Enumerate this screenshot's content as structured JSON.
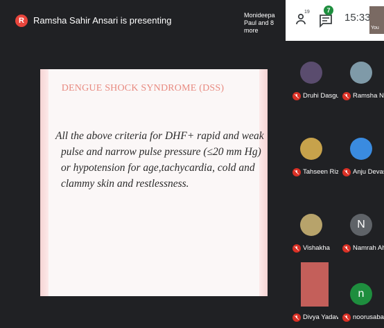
{
  "presenter": {
    "initial": "R",
    "status": "Ramsha Sahir Ansari is presenting"
  },
  "also_present": "Monideepa Paul and 8 more",
  "top_right": {
    "people_count": "19",
    "chat_badge": "7",
    "time": "15:33",
    "you_label": "You"
  },
  "slide": {
    "title": "DENGUE SHOCK SYNDROME (DSS)",
    "lines": [
      "All the above criteria for DHF+ rapid and weak",
      "pulse and narrow pulse pressure (≤20 mm Hg)",
      "or hypotension for age,tachycardia, cold and",
      "clammy skin and restlessness."
    ]
  },
  "participants": [
    {
      "name": "Druhi Dasgupta",
      "avatar": "photo",
      "color": "#5a4c6e"
    },
    {
      "name": "Ramsha Neyaz",
      "avatar": "photo",
      "color": "#7f9aa8"
    },
    {
      "name": "Tahseen Rizwan",
      "avatar": "photo",
      "color": "#c7a24b"
    },
    {
      "name": "Anju Devasia",
      "avatar": "photo",
      "color": "#3a8be0"
    },
    {
      "name": "Vishakha",
      "avatar": "photo",
      "color": "#b7a36b"
    },
    {
      "name": "Namrah Ahmed",
      "avatar": "N",
      "color": "#5f6368"
    },
    {
      "name": "Divya Yadav",
      "avatar": "photo",
      "color": "#c45f5a"
    },
    {
      "name": "noorusaba bano",
      "avatar": "n",
      "color": "#1e8e3e"
    }
  ],
  "colors": {
    "meet_dark": "#202124",
    "muted_red": "#d93025",
    "presenter_red": "#e8453c",
    "badge_green": "#1e8e3e"
  }
}
